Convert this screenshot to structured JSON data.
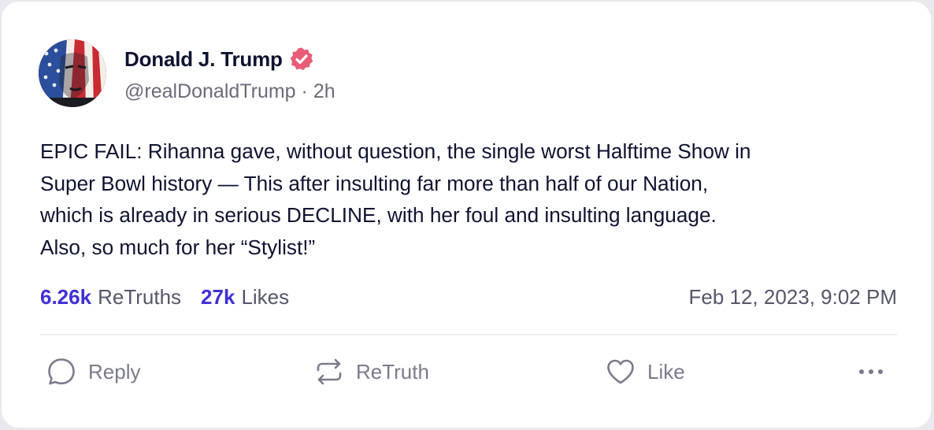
{
  "post": {
    "author": {
      "display_name": "Donald J. Trump",
      "handle": "@realDonaldTrump",
      "separator": "·",
      "time_ago": "2h",
      "verified": true
    },
    "text_lines": [
      "EPIC FAIL: Rihanna gave, without question, the single worst Halftime Show in",
      "Super Bowl history — This after insulting far more than half of our Nation,",
      "which is already in serious DECLINE, with her foul and insulting language.",
      "Also, so much for her “Stylist!”"
    ],
    "stats": {
      "retruths_count": "6.26k",
      "retruths_label": "ReTruths",
      "likes_count": "27k",
      "likes_label": "Likes",
      "timestamp": "Feb 12, 2023, 9:02 PM"
    },
    "actions": {
      "reply_label": "Reply",
      "retruth_label": "ReTruth",
      "like_label": "Like",
      "more_icon": "ellipsis-icon"
    }
  },
  "colors": {
    "accent": "#3f2fd6",
    "verified_badge": "#e85d75",
    "text_primary": "#0e1330",
    "text_secondary": "#6b6b7b"
  }
}
